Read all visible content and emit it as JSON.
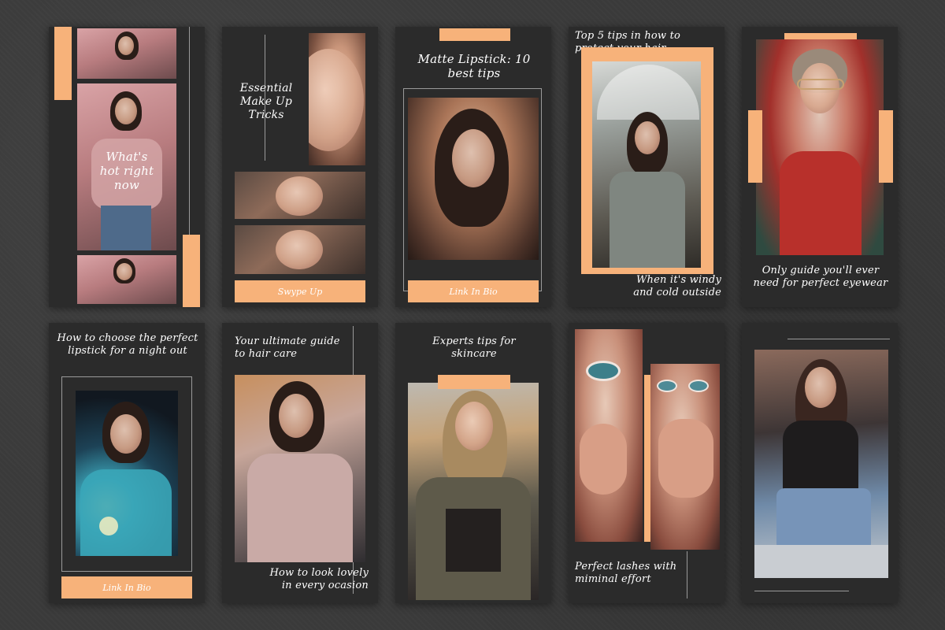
{
  "colors": {
    "accent": "#f7b27a",
    "card": "#2b2b2b",
    "background": "#3a3a3a"
  },
  "cards": {
    "c1": {
      "title": "What's hot right now"
    },
    "c2": {
      "title": "Essential Make Up Tricks",
      "button": "Swype Up"
    },
    "c3": {
      "title": "Matte Lipstick: 10 best tips",
      "button": "Link In Bio"
    },
    "c4": {
      "title": "Top 5 tips in how to protect your hair",
      "caption": "When it's windy and cold outside"
    },
    "c5": {
      "caption": "Only guide you'll ever need for perfect eyewear"
    },
    "c6": {
      "title": "How to choose the perfect lipstick for a night out",
      "button": "Link In Bio"
    },
    "c7": {
      "title": "Your ultimate guide to hair care",
      "caption": "How to look lovely in every ocasion"
    },
    "c8": {
      "title": "Experts tips for skincare"
    },
    "c9": {
      "caption": "Perfect lashes with miminal effort"
    },
    "c10": {}
  },
  "icons": [
    "photo-placeholder"
  ]
}
